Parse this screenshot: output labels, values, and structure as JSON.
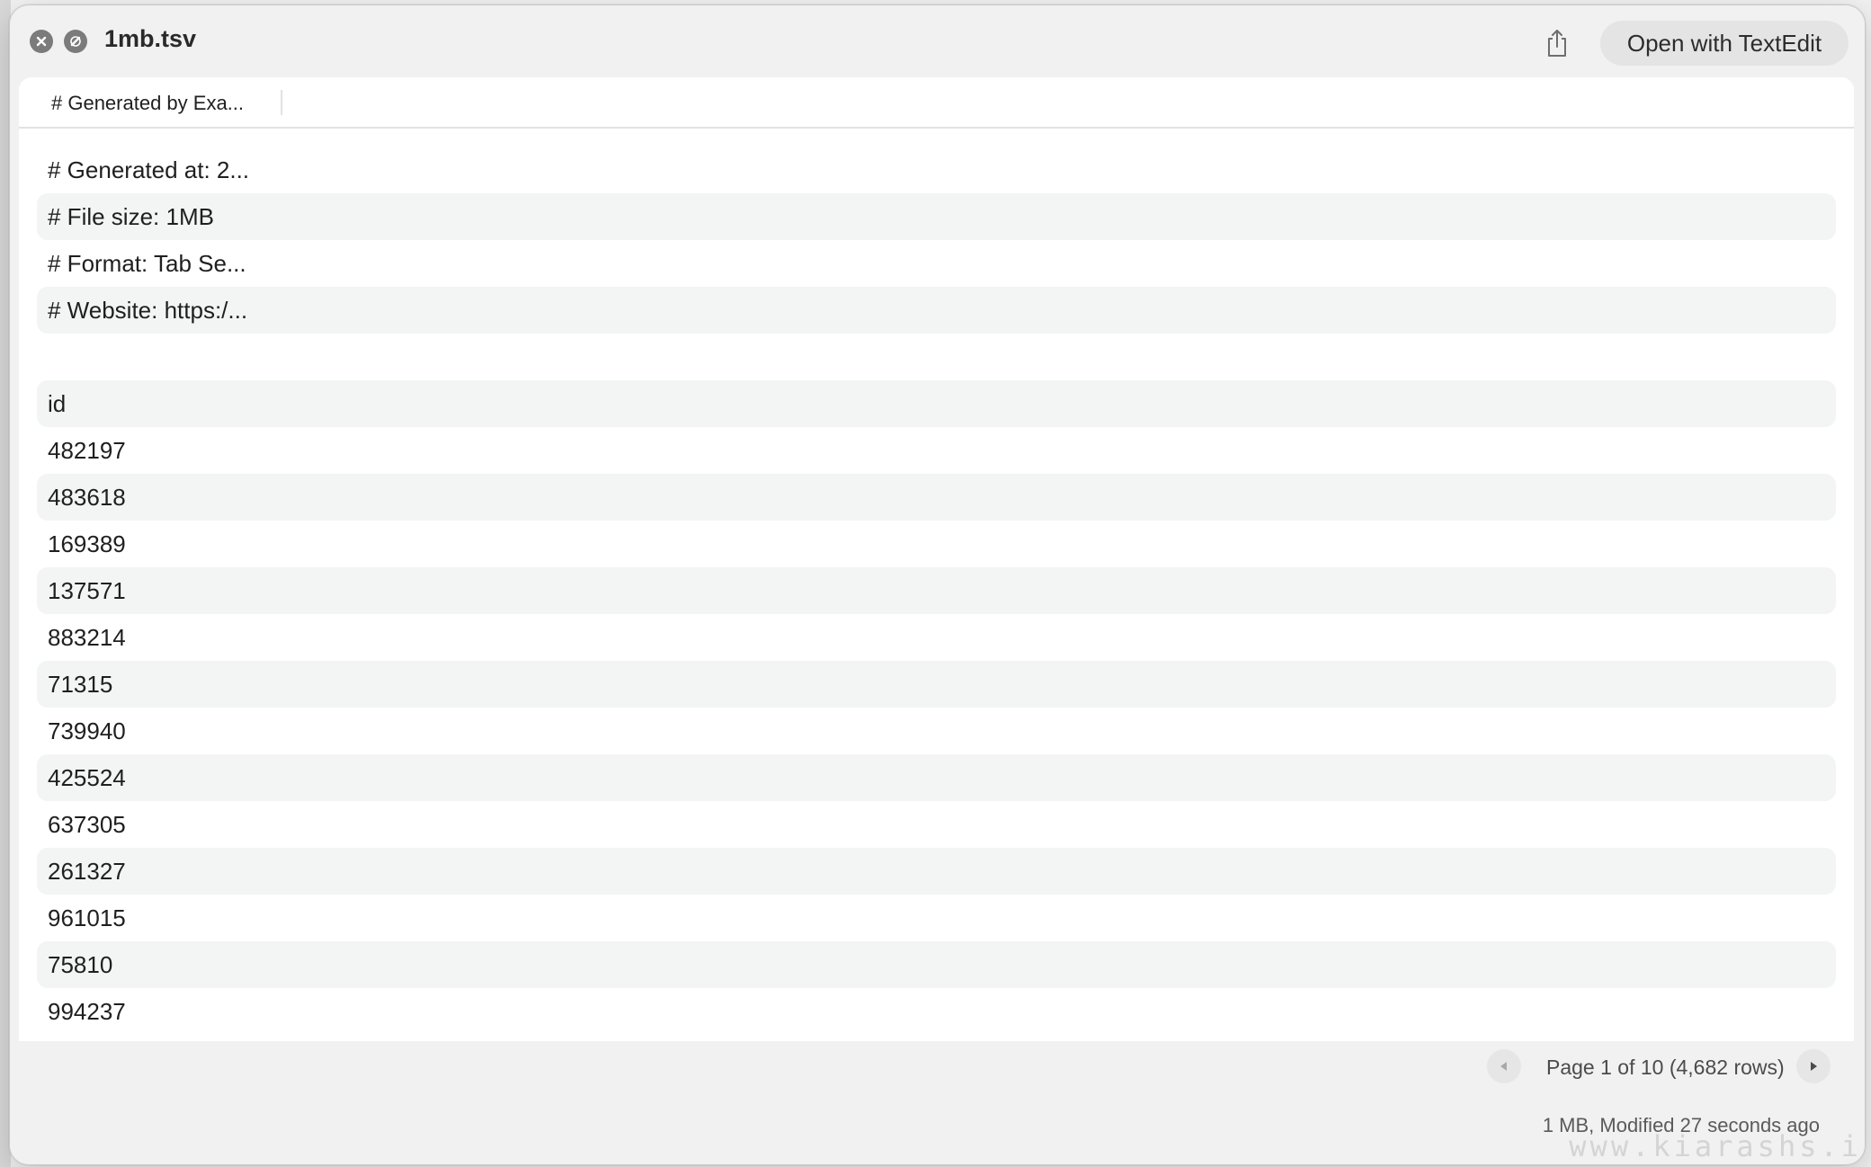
{
  "window": {
    "title": "1mb.tsv",
    "open_button_label": "Open with TextEdit"
  },
  "tabs": [
    {
      "label": "# Generated by Exa..."
    }
  ],
  "rows": [
    "# Generated at: 2...",
    "# File size: 1MB",
    "# Format: Tab Se...",
    "# Website: https:/...",
    "",
    "id",
    "482197",
    "483618",
    "169389",
    "137571",
    "883214",
    "71315",
    "739940",
    "425524",
    "637305",
    "261327",
    "961015",
    "75810",
    "994237"
  ],
  "pager": {
    "label": "Page 1 of 10 (4,682 rows)"
  },
  "status": {
    "label": "1 MB, Modified 27 seconds ago"
  },
  "watermark": "www.kiarashs.i",
  "icons": {
    "close": "close-icon",
    "markup": "markup-icon",
    "share": "share-icon",
    "prev": "chevron-left-icon",
    "next": "chevron-right-icon"
  }
}
